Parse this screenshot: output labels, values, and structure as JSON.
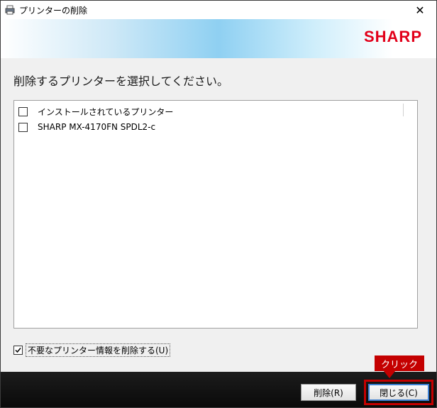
{
  "window": {
    "title": "プリンターの削除",
    "close_glyph": "✕"
  },
  "banner": {
    "logo": "SHARP",
    "logo_color": "#e2001a"
  },
  "heading": "削除するプリンターを選択してください。",
  "list": {
    "items": [
      {
        "label": "インストールされているプリンター",
        "checked": false
      },
      {
        "label": "SHARP MX-4170FN SPDL2-c",
        "checked": false
      }
    ]
  },
  "cleanup_option": {
    "label": "不要なプリンター情報を削除する(U)",
    "checked": true
  },
  "buttons": {
    "delete_label": "削除(R)",
    "close_label": "閉じる(C)"
  },
  "annotation": {
    "callout_text": "クリック",
    "color": "#c40000"
  }
}
